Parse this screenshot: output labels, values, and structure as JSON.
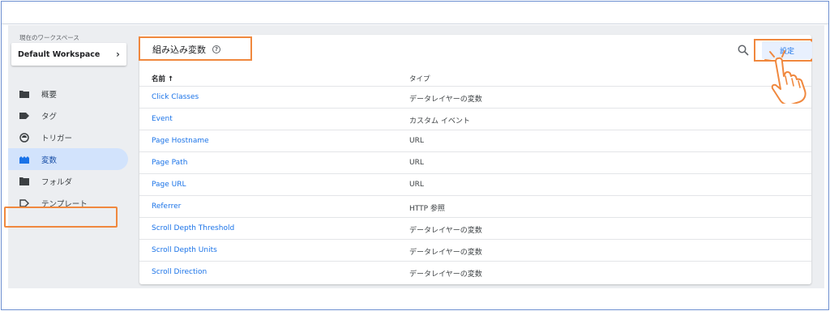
{
  "sidebar": {
    "workspace_label": "現在のワークスペース",
    "workspace_name": "Default Workspace",
    "items": [
      {
        "label": "概要",
        "icon": "folder-icon"
      },
      {
        "label": "タグ",
        "icon": "tag-icon"
      },
      {
        "label": "トリガー",
        "icon": "trigger-icon"
      },
      {
        "label": "変数",
        "icon": "variables-icon",
        "active": true
      },
      {
        "label": "フォルダ",
        "icon": "folder-icon"
      },
      {
        "label": "テンプレート",
        "icon": "template-icon"
      }
    ]
  },
  "main": {
    "title": "組み込み変数",
    "settings_label": "設定",
    "columns": {
      "name": "名前 ↑",
      "type": "タイプ"
    },
    "rows": [
      {
        "name": "Click Classes",
        "type": "データレイヤーの変数"
      },
      {
        "name": "Event",
        "type": "カスタム イベント"
      },
      {
        "name": "Page Hostname",
        "type": "URL"
      },
      {
        "name": "Page Path",
        "type": "URL"
      },
      {
        "name": "Page URL",
        "type": "URL"
      },
      {
        "name": "Referrer",
        "type": "HTTP 参照"
      },
      {
        "name": "Scroll Depth Threshold",
        "type": "データレイヤーの変数"
      },
      {
        "name": "Scroll Depth Units",
        "type": "データレイヤーの変数"
      },
      {
        "name": "Scroll Direction",
        "type": "データレイヤーの変数"
      }
    ]
  },
  "colors": {
    "accent": "#1a73e8",
    "highlight": "#f0883e",
    "active_bg": "#d2e3fc"
  }
}
